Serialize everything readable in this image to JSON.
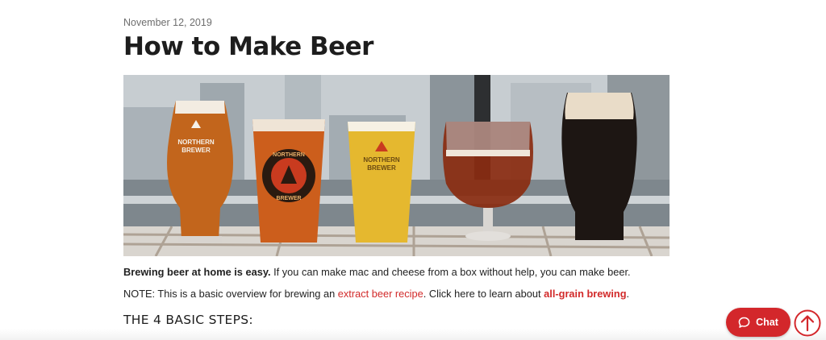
{
  "article": {
    "date": "November 12, 2019",
    "title": "How to Make Beer",
    "hero_alt": "Five glasses of Northern Brewer beer",
    "glass_texts": {
      "glass1": [
        "NORTHERN",
        "BREWER"
      ],
      "glass2": [
        "NORTHERN",
        "BREWER"
      ],
      "glass3": [
        "NORTHERN",
        "BREWER"
      ]
    },
    "intro_bold": "Brewing beer at home is easy.",
    "intro_rest": " If you can make mac and cheese from a box without help, you can make beer.",
    "note_prefix": "NOTE: This is a basic overview for brewing an ",
    "note_link1": "extract beer recipe",
    "note_middle": ". Click here to learn about ",
    "note_link2": "all-grain brewing",
    "note_suffix": ".",
    "section_heading": "THE 4 BASIC STEPS:"
  },
  "widgets": {
    "chat_label": "Chat",
    "chat_icon": "chat-bubble-icon",
    "top_icon": "arrow-up-circle-icon"
  },
  "colors": {
    "link": "#d22a2a",
    "chat_bg": "#d3272b",
    "brand_red": "#d3272b"
  }
}
